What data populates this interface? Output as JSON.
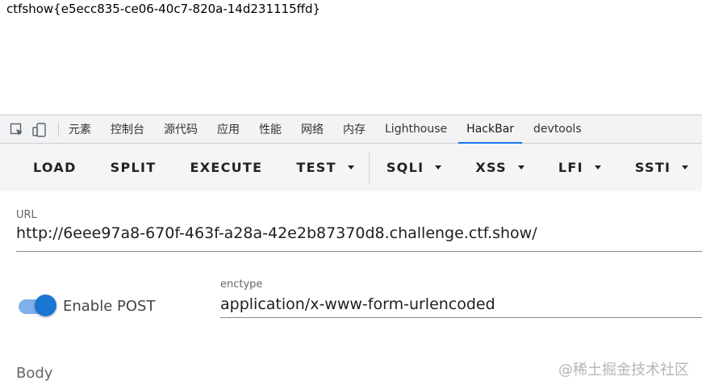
{
  "page": {
    "flag": "ctfshow{e5ecc835-ce06-40c7-820a-14d231115ffd}"
  },
  "devtools": {
    "icons": [
      "inspect-element-icon",
      "device-toolbar-icon"
    ],
    "tabs": [
      {
        "label": "元素"
      },
      {
        "label": "控制台"
      },
      {
        "label": "源代码"
      },
      {
        "label": "应用"
      },
      {
        "label": "性能"
      },
      {
        "label": "网络"
      },
      {
        "label": "内存"
      },
      {
        "label": "Lighthouse"
      },
      {
        "label": "HackBar",
        "active": true
      },
      {
        "label": "devtools"
      }
    ],
    "accent_color": "#1a73e8"
  },
  "hackbar": {
    "buttons": {
      "load": "LOAD",
      "split": "SPLIT",
      "execute": "EXECUTE",
      "test": "TEST",
      "sqli": "SQLI",
      "xss": "XSS",
      "lfi": "LFI",
      "ssti": "SSTI"
    },
    "url": {
      "label": "URL",
      "value": "http://6eee97a8-670f-463f-a28a-42e2b87370d8.challenge.ctf.show/"
    },
    "post": {
      "toggle_label": "Enable POST",
      "enabled": true,
      "toggle_color": "#1976d2"
    },
    "enctype": {
      "label": "enctype",
      "value": "application/x-www-form-urlencoded"
    },
    "body": {
      "label": "Body"
    }
  },
  "watermark": "@稀土掘金技术社区"
}
